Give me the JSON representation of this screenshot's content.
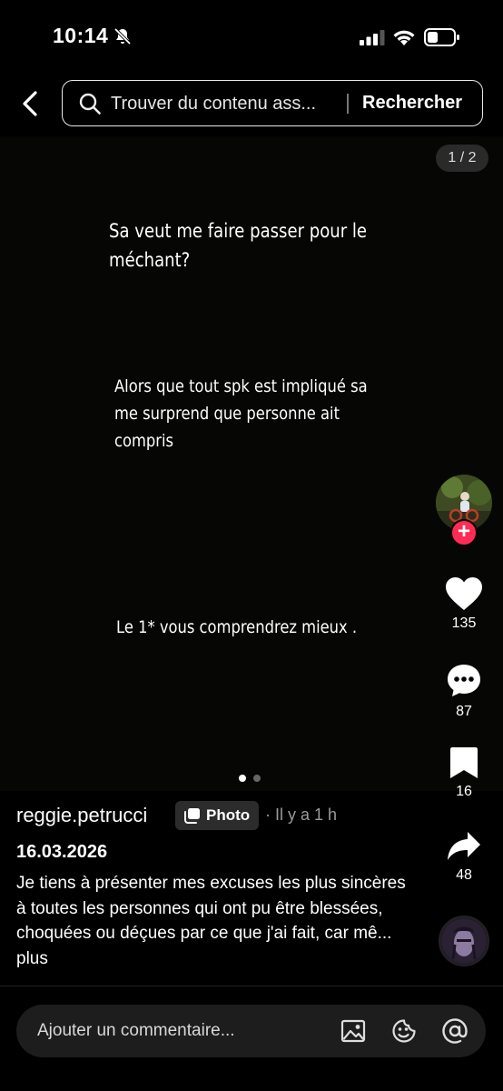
{
  "status_bar": {
    "time": "10:14"
  },
  "search": {
    "placeholder": "Trouver du contenu ass...",
    "button_label": "Rechercher"
  },
  "page_counter": "1 / 2",
  "captions": [
    "Sa veut me faire passer pour le méchant?",
    "Alors que tout spk est impliqué sa me surprend que personne ait compris",
    "Le 1* vous comprendrez mieux ."
  ],
  "sidebar": {
    "likes": "135",
    "comments": "87",
    "saves": "16",
    "shares": "48"
  },
  "post": {
    "username": "reggie.petrucci",
    "badge": "Photo",
    "time_ago": "· Il y a 1 h",
    "date": "16.03.2026",
    "description": "Je tiens à présenter mes excuses les plus sincères à toutes les personnes qui ont pu être blessées, choquées ou déçues par ce que j'ai fait, car mê...",
    "more": "plus"
  },
  "comment": {
    "placeholder": "Ajouter un commentaire..."
  },
  "colors": {
    "accent": "#fe2c55",
    "background": "#000000"
  }
}
